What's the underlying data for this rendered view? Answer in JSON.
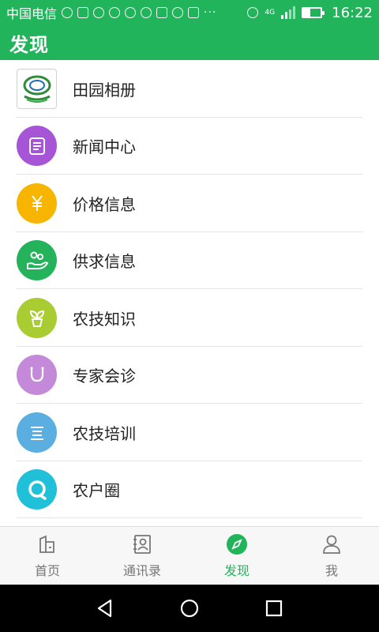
{
  "status_bar": {
    "carrier": "中国电信",
    "network": "4G",
    "time": "16:22",
    "more": "···"
  },
  "header": {
    "title": "发现"
  },
  "list_items": [
    {
      "name": "album",
      "label": "田园相册",
      "icon": "album-logo-icon",
      "color": "#ffffff"
    },
    {
      "name": "news",
      "label": "新闻中心",
      "icon": "newspaper-icon",
      "color": "#a655d6"
    },
    {
      "name": "price",
      "label": "价格信息",
      "icon": "yuan-icon",
      "color": "#f7b500"
    },
    {
      "name": "supply",
      "label": "供求信息",
      "icon": "hand-people-icon",
      "color": "#24b35b"
    },
    {
      "name": "knowledge",
      "label": "农技知识",
      "icon": "sprout-icon",
      "color": "#a8cc32"
    },
    {
      "name": "expert",
      "label": "专家会诊",
      "icon": "stethoscope-icon",
      "color": "#c48ad9"
    },
    {
      "name": "training",
      "label": "农技培训",
      "icon": "lines-icon",
      "color": "#5aaee0"
    },
    {
      "name": "circle",
      "label": "农户圈",
      "icon": "chat-circle-icon",
      "color": "#1fc0d8"
    }
  ],
  "bottom_nav": [
    {
      "name": "home",
      "label": "首页",
      "icon": "home-icon",
      "active": false
    },
    {
      "name": "contacts",
      "label": "通讯录",
      "icon": "contacts-icon",
      "active": false
    },
    {
      "name": "discover",
      "label": "发现",
      "icon": "compass-icon",
      "active": true
    },
    {
      "name": "me",
      "label": "我",
      "icon": "person-icon",
      "active": false
    }
  ],
  "colors": {
    "brand_green": "#22b45b",
    "inactive_gray": "#777777"
  }
}
